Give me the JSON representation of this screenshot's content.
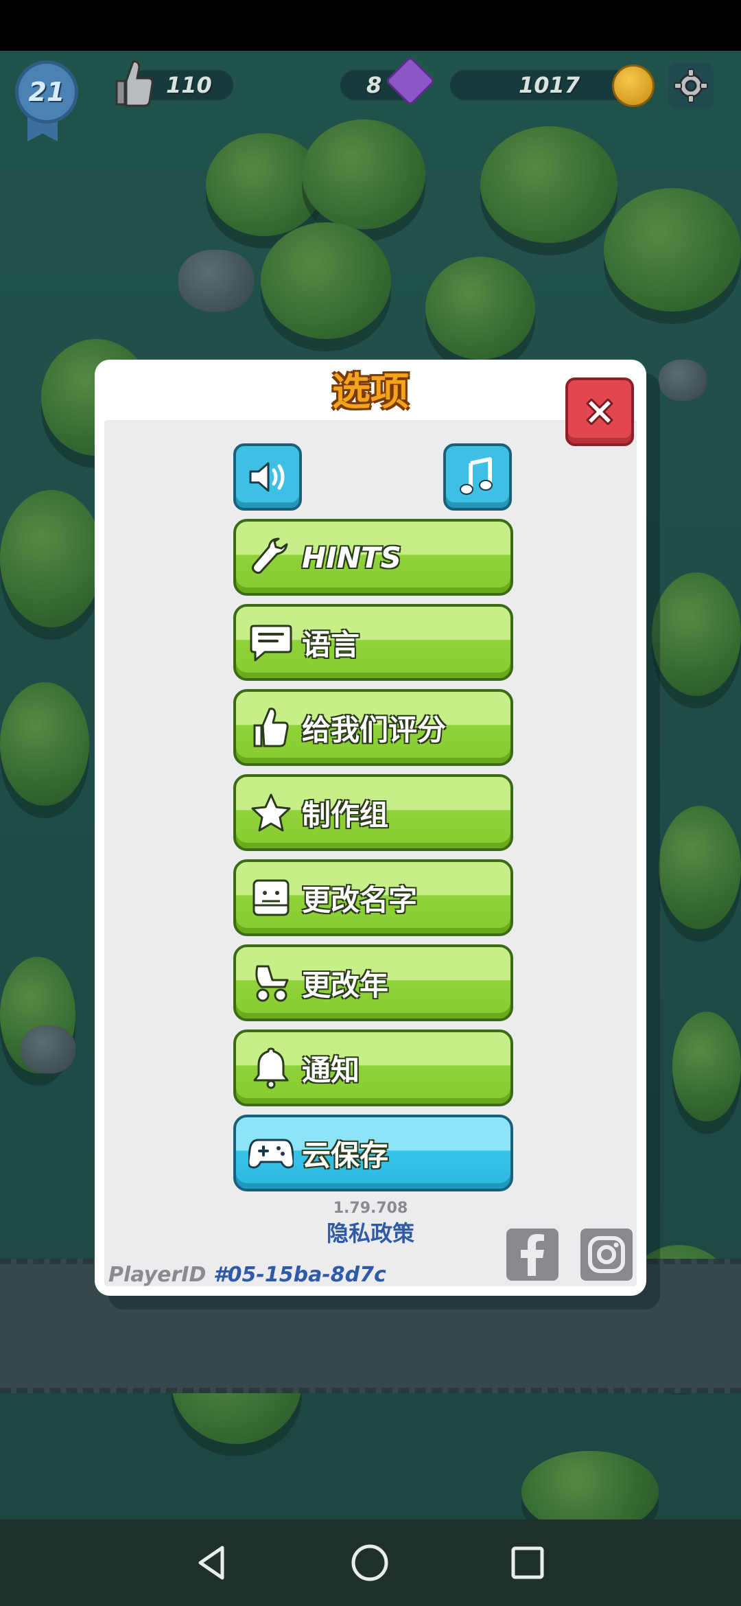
{
  "hud": {
    "level": "21",
    "likes": "110",
    "gems": "8",
    "coins": "1017",
    "icons": {
      "level": "ribbon-badge-icon",
      "likes": "thumbs-up-icon",
      "gems": "purple-gem-icon",
      "coins": "gold-coin-icon",
      "settings": "gear-icon"
    }
  },
  "dialog": {
    "title": "选项",
    "close_icon": "close-x-icon",
    "sound_icon": "speaker-icon",
    "music_icon": "music-note-icon",
    "buttons": [
      {
        "label": "HINTS",
        "icon": "wrench-icon",
        "style": "green"
      },
      {
        "label": "语言",
        "icon": "chat-bubble-icon",
        "style": "green"
      },
      {
        "label": "给我们评分",
        "icon": "thumbs-up-icon",
        "style": "green"
      },
      {
        "label": "制作组",
        "icon": "star-icon",
        "style": "green"
      },
      {
        "label": "更改名字",
        "icon": "name-card-icon",
        "style": "green"
      },
      {
        "label": "更改年",
        "icon": "stroller-icon",
        "style": "green"
      },
      {
        "label": "通知",
        "icon": "bell-icon",
        "style": "green"
      },
      {
        "label": "云保存",
        "icon": "gamepad-icon",
        "style": "blue"
      }
    ],
    "version": "1.79.708",
    "privacy_link": "隐私政策",
    "player_id_label": "PlayerID",
    "player_id": "#05-15ba-8d7c",
    "social": {
      "facebook": "facebook-icon",
      "instagram": "instagram-icon"
    }
  },
  "colors": {
    "green_button": "#8fd23a",
    "blue_button": "#38c3e8",
    "close_button": "#e0474f",
    "title_orange": "#f4a31c",
    "link_blue": "#2f5aa8"
  },
  "navbar": {
    "back": "back-triangle-icon",
    "home": "home-circle-icon",
    "recents": "recents-square-icon"
  }
}
